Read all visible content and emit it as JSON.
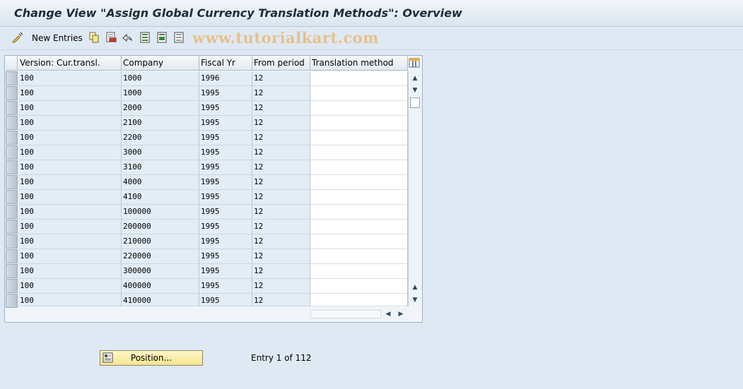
{
  "window": {
    "title": "Change View \"Assign Global Currency Translation Methods\": Overview"
  },
  "toolbar": {
    "new_entries_label": "New Entries",
    "watermark": "www.tutorialkart.com",
    "icons": [
      "display-change-icon",
      "copy-icon",
      "delete-icon",
      "undo-icon",
      "select-all-icon",
      "select-block-icon",
      "deselect-all-icon"
    ]
  },
  "table": {
    "headers": [
      "Version: Cur.transl.",
      "Company",
      "Fiscal Yr",
      "From period",
      "Translation method"
    ],
    "rows": [
      [
        "100",
        "1000",
        "1996",
        "12",
        ""
      ],
      [
        "100",
        "1000",
        "1995",
        "12",
        ""
      ],
      [
        "100",
        "2000",
        "1995",
        "12",
        ""
      ],
      [
        "100",
        "2100",
        "1995",
        "12",
        ""
      ],
      [
        "100",
        "2200",
        "1995",
        "12",
        ""
      ],
      [
        "100",
        "3000",
        "1995",
        "12",
        ""
      ],
      [
        "100",
        "3100",
        "1995",
        "12",
        ""
      ],
      [
        "100",
        "4000",
        "1995",
        "12",
        ""
      ],
      [
        "100",
        "4100",
        "1995",
        "12",
        ""
      ],
      [
        "100",
        "100000",
        "1995",
        "12",
        ""
      ],
      [
        "100",
        "200000",
        "1995",
        "12",
        ""
      ],
      [
        "100",
        "210000",
        "1995",
        "12",
        ""
      ],
      [
        "100",
        "220000",
        "1995",
        "12",
        ""
      ],
      [
        "100",
        "300000",
        "1995",
        "12",
        ""
      ],
      [
        "100",
        "400000",
        "1995",
        "12",
        ""
      ],
      [
        "100",
        "410000",
        "1995",
        "12",
        ""
      ]
    ]
  },
  "footer": {
    "position_button_label": "Position...",
    "entry_info": "Entry 1 of 112"
  },
  "colors": {
    "background": "#dfe9f3",
    "title_text": "#1d2b3a",
    "watermark": "#e7c08a",
    "button_yellow": "#f5e58e"
  }
}
